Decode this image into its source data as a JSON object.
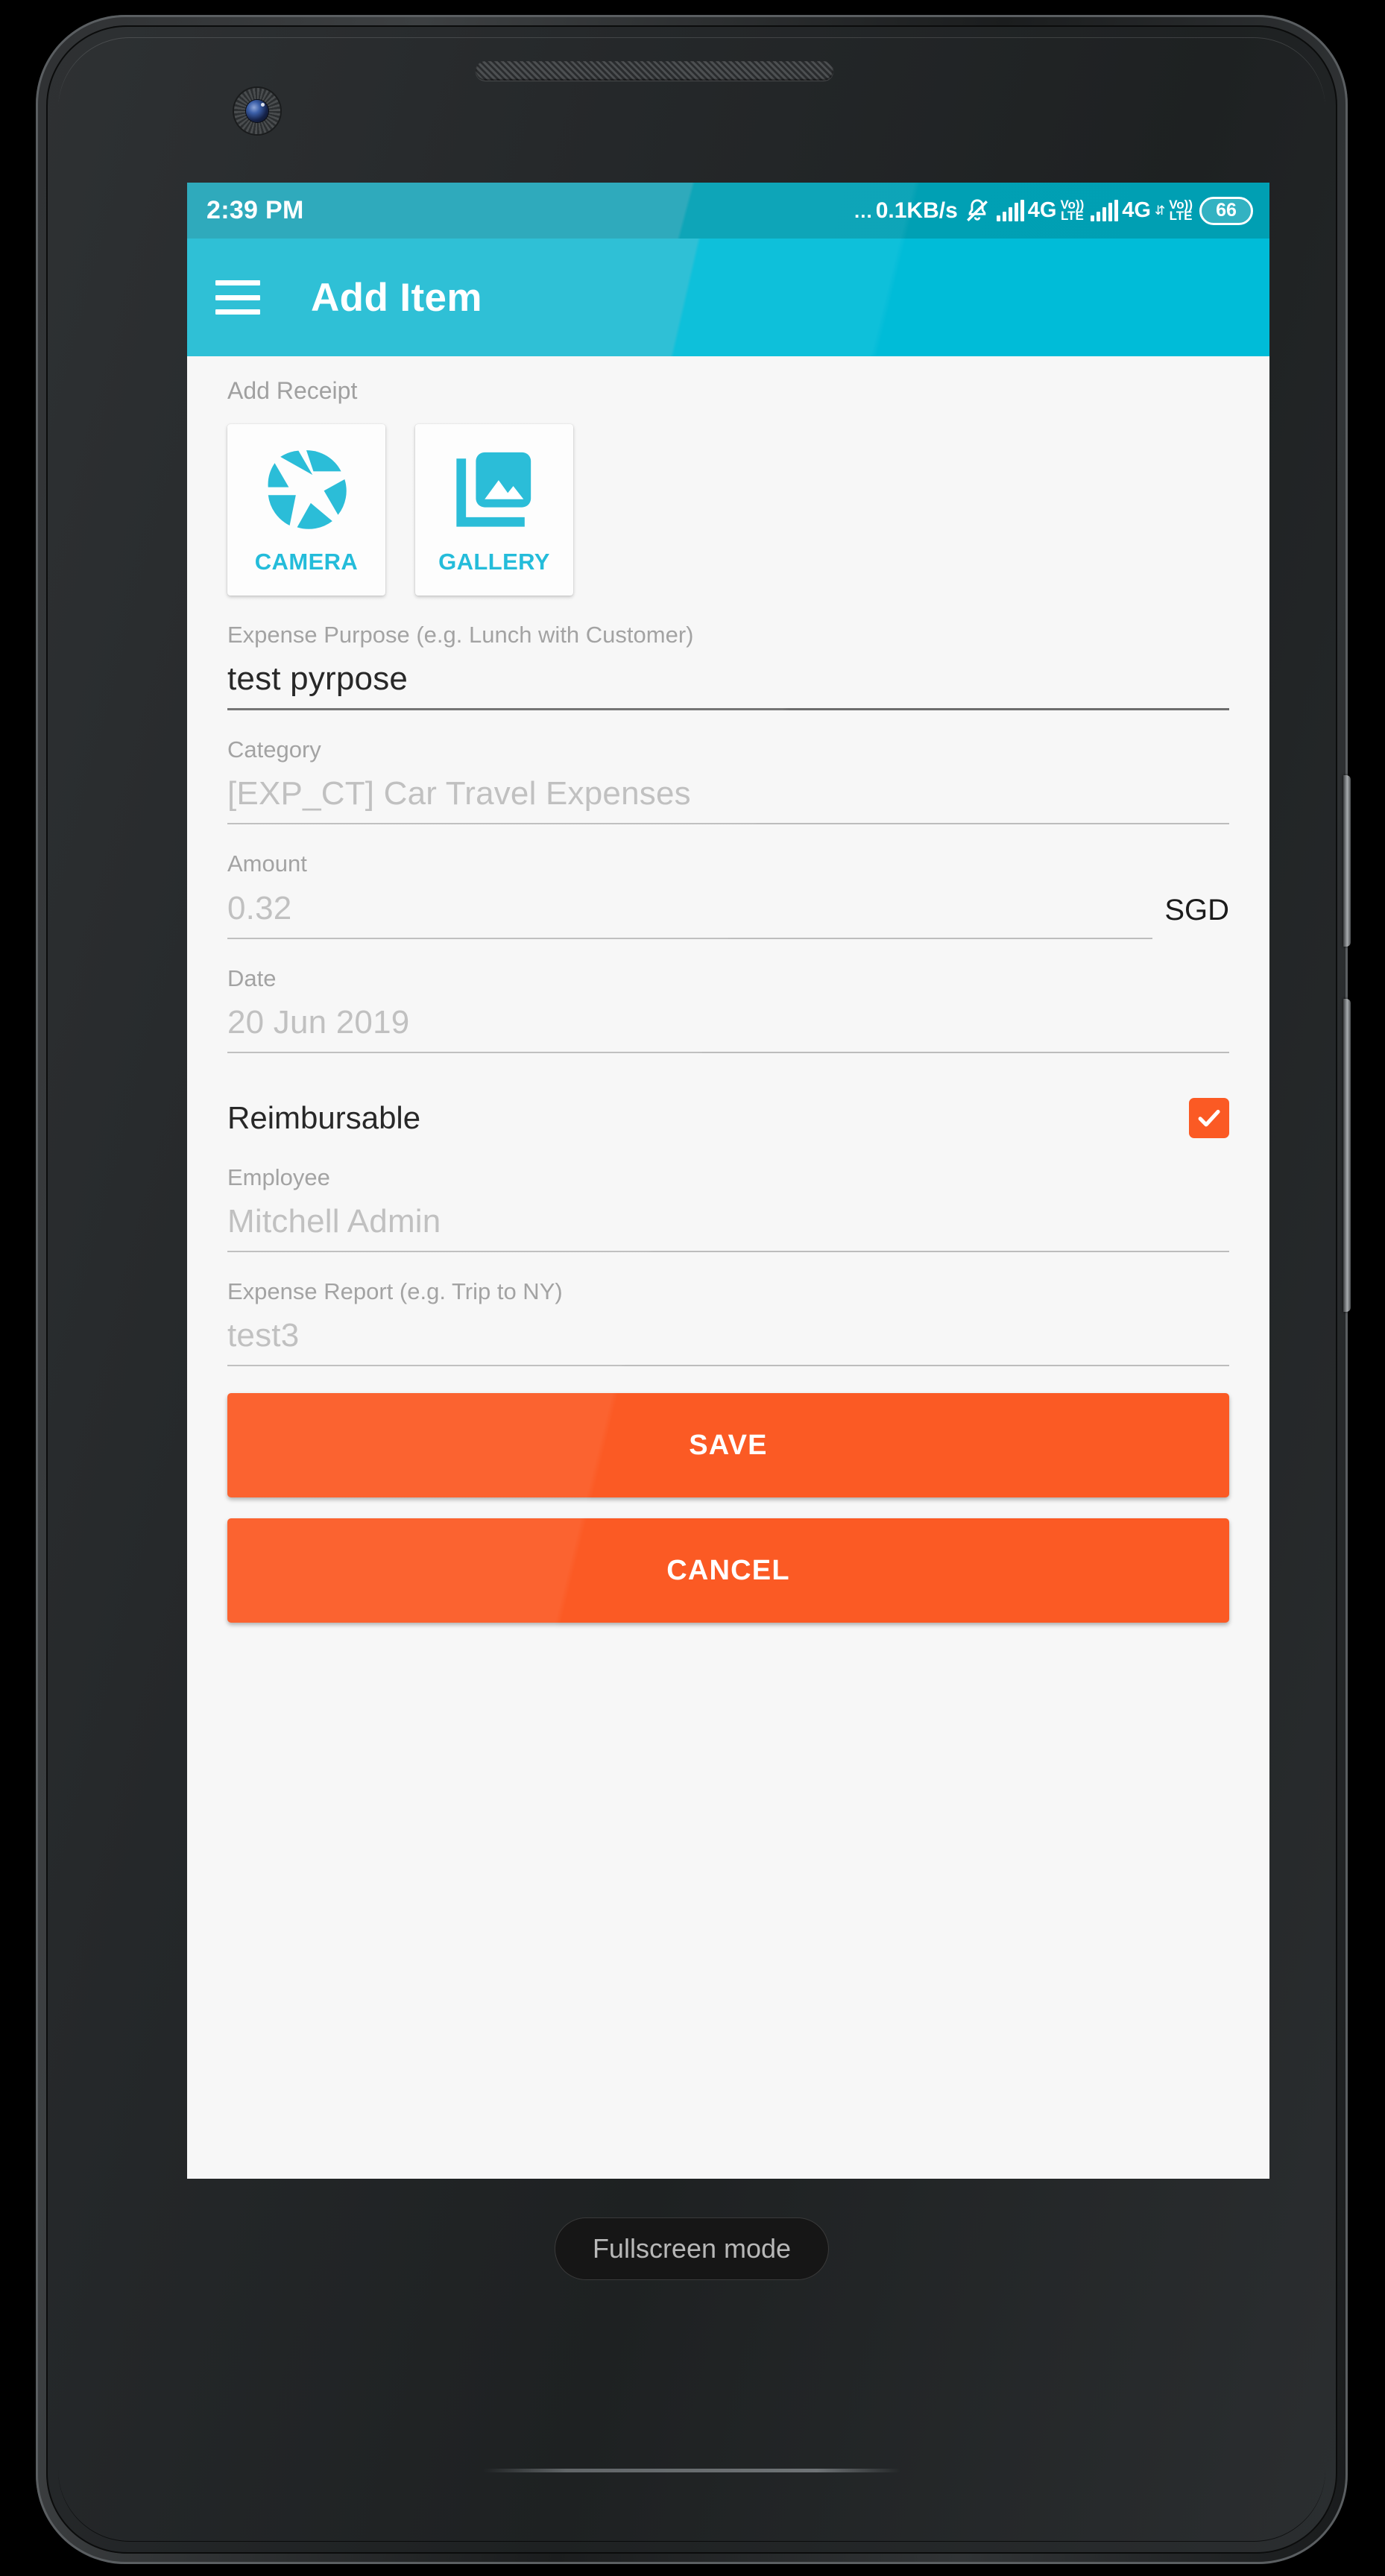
{
  "status_bar": {
    "time": "2:39 PM",
    "net_speed_dots": "...",
    "net_speed": "0.1KB/s",
    "bell_icon": "bell-muted-icon",
    "sim1": {
      "signal_icon": "signal-bars-icon",
      "network": "4G",
      "volte_top": "Vo))",
      "volte_bottom": "LTE"
    },
    "sim2": {
      "signal_icon": "signal-bars-icon",
      "network": "4G",
      "data_arrows": "⇵",
      "volte_top": "Vo))",
      "volte_bottom": "LTE"
    },
    "battery": "66"
  },
  "app_bar": {
    "menu_icon": "hamburger-menu-icon",
    "title": "Add Item",
    "background_color": "#00bcd8"
  },
  "receipt": {
    "section_label": "Add Receipt",
    "options": [
      {
        "icon": "camera-aperture-icon",
        "label": "CAMERA"
      },
      {
        "icon": "photo-library-icon",
        "label": "GALLERY"
      }
    ],
    "accent_color": "#17b8d8"
  },
  "form": {
    "purpose": {
      "label": "Expense Purpose (e.g. Lunch with Customer)",
      "value": "test pyrpose",
      "filled": true
    },
    "category": {
      "label": "Category",
      "value": "[EXP_CT] Car Travel Expenses",
      "filled": false
    },
    "amount": {
      "label": "Amount",
      "value": "0.32",
      "currency": "SGD",
      "filled": false
    },
    "date": {
      "label": "Date",
      "value": "20 Jun 2019",
      "filled": false
    },
    "reimbursable": {
      "label": "Reimbursable",
      "checked": true,
      "check_color": "#fb5a24"
    },
    "employee": {
      "label": "Employee",
      "value": "Mitchell Admin",
      "filled": false
    },
    "expense_report": {
      "label": "Expense Report (e.g. Trip to NY)",
      "value": "test3",
      "filled": false
    }
  },
  "actions": {
    "save_label": "SAVE",
    "cancel_label": "CANCEL",
    "button_color": "#fb5a24"
  },
  "system_overlay": {
    "fullscreen_pill": "Fullscreen mode"
  }
}
